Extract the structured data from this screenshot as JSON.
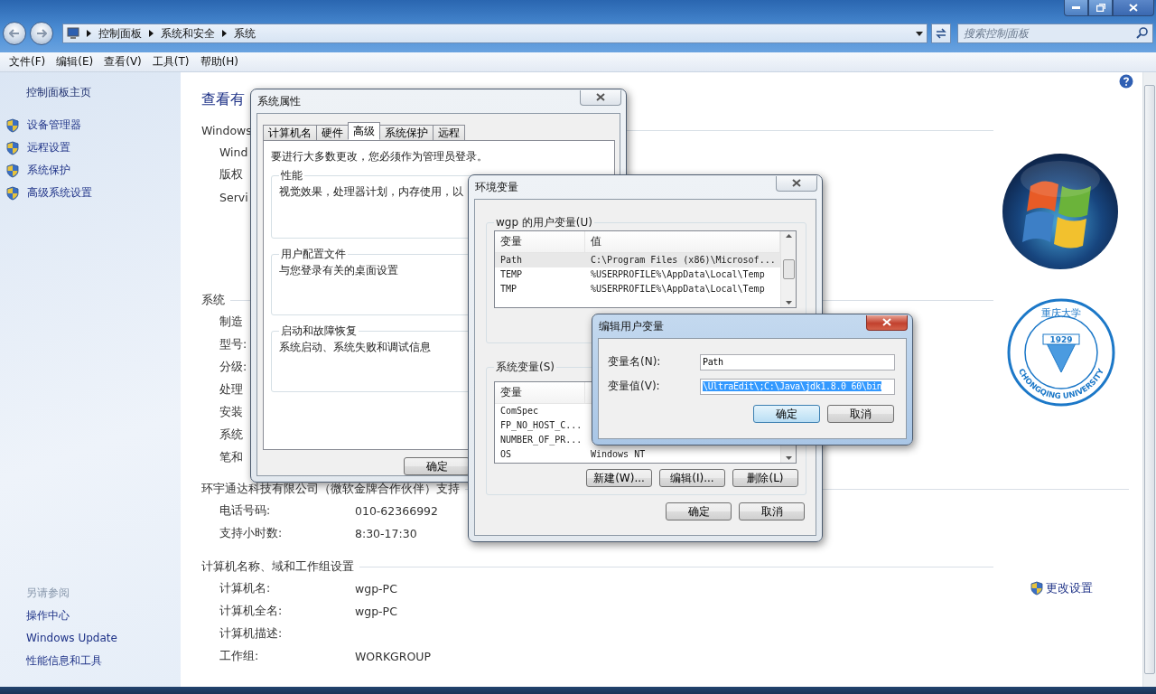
{
  "address_bar": {
    "breadcrumbs": [
      "控制面板",
      "系统和安全",
      "系统"
    ]
  },
  "search": {
    "placeholder": "搜索控制面板"
  },
  "menu": [
    "文件(F)",
    "编辑(E)",
    "查看(V)",
    "工具(T)",
    "帮助(H)"
  ],
  "sidebar": {
    "home": "控制面板主页",
    "tasks": [
      "设备管理器",
      "远程设置",
      "系统保护",
      "高级系统设置"
    ],
    "see_also": {
      "title": "另请参阅",
      "links": [
        "操作中心",
        "Windows Update",
        "性能信息和工具"
      ]
    }
  },
  "main": {
    "heading": "查看有",
    "sections": [
      {
        "kind": "windows",
        "title": "Windows",
        "rows": [
          {
            "label": "Wind"
          },
          {
            "label": "版权"
          },
          {
            "label": "Servi"
          }
        ]
      },
      {
        "kind": "system",
        "title": "系统",
        "rows": [
          {
            "label": "制造"
          },
          {
            "label": "型号:"
          },
          {
            "label": "分级:"
          },
          {
            "label": "处理"
          },
          {
            "label": "安装"
          },
          {
            "label": "系统"
          },
          {
            "label": "笔和"
          }
        ]
      },
      {
        "kind": "plain",
        "title": "环宇通达科技有限公司（微软金牌合作伙伴）支持",
        "rows": [
          {
            "label": "电话号码:",
            "value": "010-62366992"
          },
          {
            "label": "支持小时数:",
            "value": "8:30-17:30"
          }
        ]
      },
      {
        "kind": "computer",
        "title": "计算机名称、域和工作组设置",
        "action": "更改设置",
        "rows": [
          {
            "label": "计算机名:",
            "value": "wgp-PC"
          },
          {
            "label": "计算机全名:",
            "value": "wgp-PC"
          },
          {
            "label": "计算机描述:"
          },
          {
            "label": "工作组:",
            "value": "WORKGROUP"
          }
        ]
      }
    ],
    "seal": {
      "calligraphy": "重庆大学",
      "year": "1929",
      "name": "CHONGQING UNIVERSITY"
    }
  },
  "sys_props": {
    "title": "系统属性",
    "tabs": [
      {
        "label": "计算机名",
        "selected": false
      },
      {
        "label": "硬件",
        "selected": false
      },
      {
        "label": "高级",
        "selected": true
      },
      {
        "label": "系统保护",
        "selected": false
      },
      {
        "label": "远程",
        "selected": false
      }
    ],
    "notice": "要进行大多数更改，您必须作为管理员登录。",
    "groups": [
      {
        "title": "性能",
        "text": "视觉效果，处理器计划，内存使用，以"
      },
      {
        "title": "用户配置文件",
        "text": "与您登录有关的桌面设置"
      },
      {
        "title": "启动和故障恢复",
        "text": "系统启动、系统失败和调试信息"
      }
    ],
    "button": "确定"
  },
  "env": {
    "title": "环境变量",
    "user_group": {
      "title": "wgp 的用户变量(U)",
      "columns": [
        "变量",
        "值"
      ],
      "rows": [
        {
          "name": "Path",
          "value": "C:\\Program Files (x86)\\Microsof...",
          "selected": true
        },
        {
          "name": "TEMP",
          "value": "%USERPROFILE%\\AppData\\Local\\Temp",
          "selected": false
        },
        {
          "name": "TMP",
          "value": "%USERPROFILE%\\AppData\\Local\\Temp",
          "selected": false
        }
      ]
    },
    "system_group": {
      "title": "系统变量(S)",
      "columns": [
        "变量"
      ],
      "rows": [
        {
          "name": "ComSpec",
          "selected": false
        },
        {
          "name": "FP_NO_HOST_C...",
          "selected": false
        },
        {
          "name": "NUMBER_OF_PR...",
          "selected": false
        },
        {
          "name": "OS",
          "value": "Windows NT",
          "selected": false
        }
      ],
      "buttons": [
        "新建(W)...",
        "编辑(I)...",
        "删除(L)"
      ]
    },
    "buttons": [
      "确定",
      "取消"
    ]
  },
  "edit": {
    "title": "编辑用户变量",
    "fields": [
      {
        "label": "变量名(N):",
        "value": "Path",
        "highlighted": false
      },
      {
        "label": "变量值(V):",
        "value": "\\UltraEdit\\;C:\\Java\\jdk1.8.0_60\\bin",
        "highlighted": true
      }
    ],
    "buttons": [
      {
        "label": "确定",
        "default": true
      },
      {
        "label": "取消",
        "default": false
      }
    ]
  }
}
